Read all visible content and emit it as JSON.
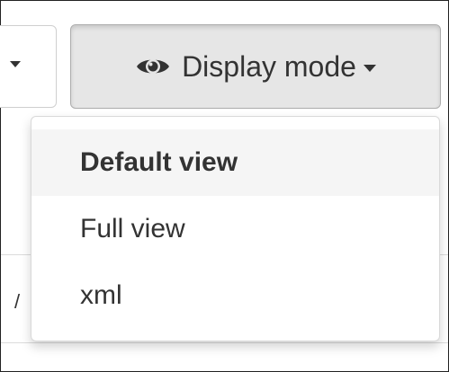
{
  "display_mode_button": {
    "icon": "eye-icon",
    "label": "Display mode"
  },
  "menu": {
    "items": [
      {
        "label": "Default view",
        "selected": true
      },
      {
        "label": "Full view",
        "selected": false
      },
      {
        "label": "xml",
        "selected": false
      }
    ]
  },
  "edge_glyph": "/"
}
